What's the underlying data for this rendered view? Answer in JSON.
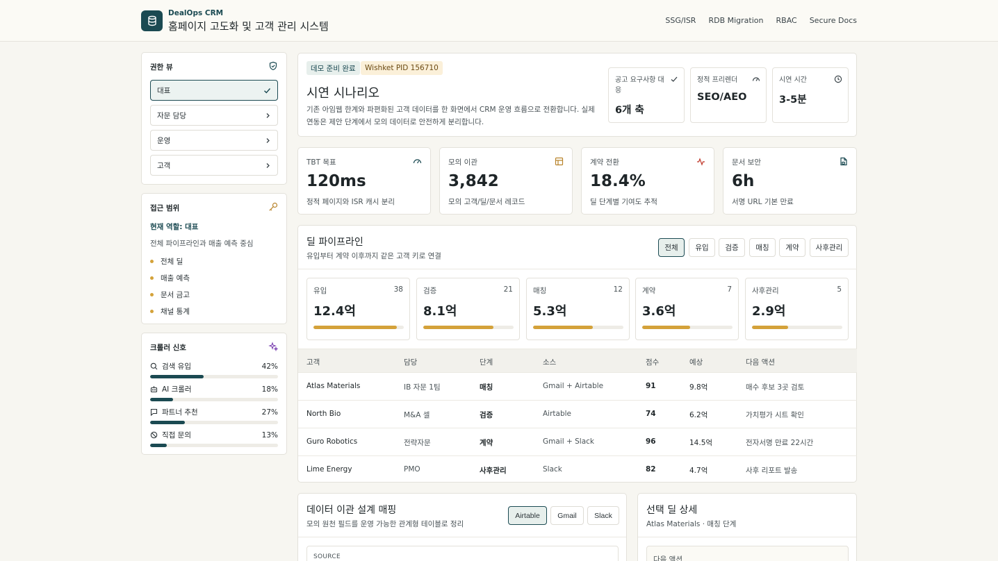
{
  "header": {
    "brand_sub": "DealOps CRM",
    "brand_title": "홈페이지 고도화 및 고객 관리 시스템",
    "nav": [
      "SSG/ISR",
      "RDB Migration",
      "RBAC",
      "Secure Docs"
    ]
  },
  "roles": {
    "title": "권한 뷰",
    "items": [
      {
        "label": "대표",
        "active": true
      },
      {
        "label": "자문 담당",
        "active": false
      },
      {
        "label": "운영",
        "active": false
      },
      {
        "label": "고객",
        "active": false
      }
    ]
  },
  "scope": {
    "title": "접근 범위",
    "current_role": "현재 역할: 대표",
    "description": "전체 파이프라인과 매출 예측 중심",
    "items": [
      "전체 딜",
      "매출 예측",
      "문서 금고",
      "채널 통계"
    ]
  },
  "signals": {
    "title": "크롤러 신호",
    "items": [
      {
        "label": "검색 유입",
        "value": "42%",
        "fraction": 0.42,
        "icon": "search-icon"
      },
      {
        "label": "AI 크롤러",
        "value": "18%",
        "fraction": 0.18,
        "icon": "bot-icon"
      },
      {
        "label": "파트너 추천",
        "value": "27%",
        "fraction": 0.27,
        "icon": "message-icon"
      },
      {
        "label": "직접 문의",
        "value": "13%",
        "fraction": 0.13,
        "icon": "globe-icon"
      }
    ]
  },
  "scenario": {
    "badge_status": "데모 준비 완료",
    "badge_pid": "Wishket PID 156710",
    "title": "시연 시나리오",
    "description": "기존 아임웹 한계와 파편화된 고객 데이터를 한 화면에서 CRM 운영 흐름으로 전환합니다. 실제 연동은 제안 단계에서 모의 데이터로 안전하게 분리합니다.",
    "stats": [
      {
        "label": "공고 요구사항 대응",
        "value": "6개 축"
      },
      {
        "label": "정적 프리렌더",
        "value": "SEO/AEO"
      },
      {
        "label": "시연 시간",
        "value": "3-5분"
      }
    ]
  },
  "kpis": [
    {
      "label": "TBT 목표",
      "value": "120ms",
      "sub": "정적 페이지와 ISR 캐시 분리"
    },
    {
      "label": "모의 이관",
      "value": "3,842",
      "sub": "모의 고객/딜/문서 레코드"
    },
    {
      "label": "계약 전환",
      "value": "18.4%",
      "sub": "딜 단계별 기여도 추적"
    },
    {
      "label": "문서 보안",
      "value": "6h",
      "sub": "서명 URL 기본 만료"
    }
  ],
  "pipeline": {
    "title": "딜 파이프라인",
    "subtitle": "유입부터 계약 이후까지 같은 고객 키로 연결",
    "filters": [
      "전체",
      "유입",
      "검증",
      "매칭",
      "계약",
      "사후관리"
    ],
    "active_filter": "전체",
    "stages": [
      {
        "name": "유입",
        "count": "38",
        "amount": "12.4억",
        "fraction": 0.92
      },
      {
        "name": "검증",
        "count": "21",
        "amount": "8.1억",
        "fraction": 0.78
      },
      {
        "name": "매칭",
        "count": "12",
        "amount": "5.3억",
        "fraction": 0.66
      },
      {
        "name": "계약",
        "count": "7",
        "amount": "3.6억",
        "fraction": 0.53
      },
      {
        "name": "사후관리",
        "count": "5",
        "amount": "2.9억",
        "fraction": 0.4
      }
    ],
    "columns": [
      "고객",
      "담당",
      "단계",
      "소스",
      "점수",
      "예상",
      "다음 액션"
    ],
    "rows": [
      [
        "Atlas Materials",
        "IB 자문 1팀",
        "매칭",
        "Gmail + Airtable",
        "91",
        "9.8억",
        "매수 후보 3곳 검토"
      ],
      [
        "North Bio",
        "M&A 셀",
        "검증",
        "Airtable",
        "74",
        "6.2억",
        "가치평가 시트 확인"
      ],
      [
        "Guro Robotics",
        "전략자문",
        "계약",
        "Gmail + Slack",
        "96",
        "14.5억",
        "전자서명 만료 22시간"
      ],
      [
        "Lime Energy",
        "PMO",
        "사후관리",
        "Slack",
        "82",
        "4.7억",
        "사후 리포트 발송"
      ]
    ]
  },
  "mapping": {
    "title": "데이터 이관 설계 매핑",
    "subtitle": "모의 원천 필드를 운영 가능한 관계형 테이블로 정리",
    "sources": [
      "Airtable",
      "Gmail",
      "Slack"
    ],
    "active_source": "Airtable",
    "source_label": "SOURCE"
  },
  "detail": {
    "title": "선택 딜 상세",
    "subtitle": "Atlas Materials · 매칭 단계",
    "next_action_label": "다음 액션"
  },
  "colors": {
    "accent": "#1b4a52",
    "gold": "#d4a23a",
    "background": "#f7f6f1"
  }
}
